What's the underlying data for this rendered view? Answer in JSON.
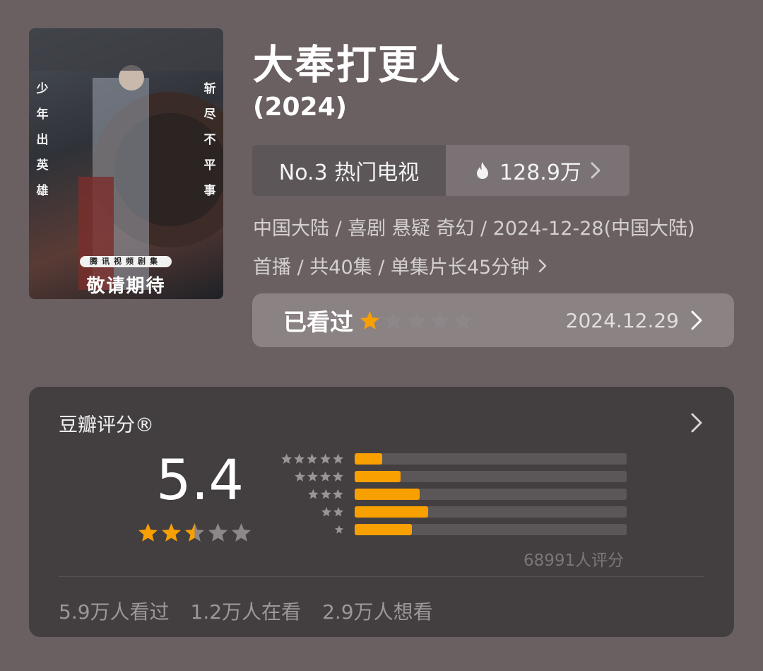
{
  "poster": {
    "side_left": "少年出英雄",
    "side_right": "斩尽不平事",
    "badge": "腾讯视频剧集",
    "slogan": "敬请期待"
  },
  "title": "大奉打更人",
  "year": "(2024)",
  "rank": {
    "label": "No.3 热门电视",
    "heat": "128.9万"
  },
  "meta": {
    "line1": "中国大陆 / 喜剧 悬疑 奇幻 / 2024-12-28(中国大陆)",
    "line2": "首播 / 共40集 / 单集片长45分钟"
  },
  "watched": {
    "label": "已看过",
    "user_rating": 1,
    "date": "2024.12.29"
  },
  "douban": {
    "title": "豆瓣评分®",
    "score": "5.4",
    "score_stars": 2.5,
    "distribution": [
      {
        "stars": 5,
        "fraction": 0.1
      },
      {
        "stars": 4,
        "fraction": 0.17
      },
      {
        "stars": 3,
        "fraction": 0.24
      },
      {
        "stars": 2,
        "fraction": 0.27
      },
      {
        "stars": 1,
        "fraction": 0.21
      }
    ],
    "count": "68991人评分",
    "stats": {
      "watched": "5.9万人看过",
      "watching": "1.2万人在看",
      "want": "2.9万人想看"
    }
  },
  "colors": {
    "background": "#6a6062",
    "card": "#433e3f",
    "accent": "#f7a000",
    "star_empty": "#8d8789"
  },
  "icons": {
    "heat": "flame-icon",
    "chevron": "chevron-right-icon",
    "star": "star-icon"
  }
}
